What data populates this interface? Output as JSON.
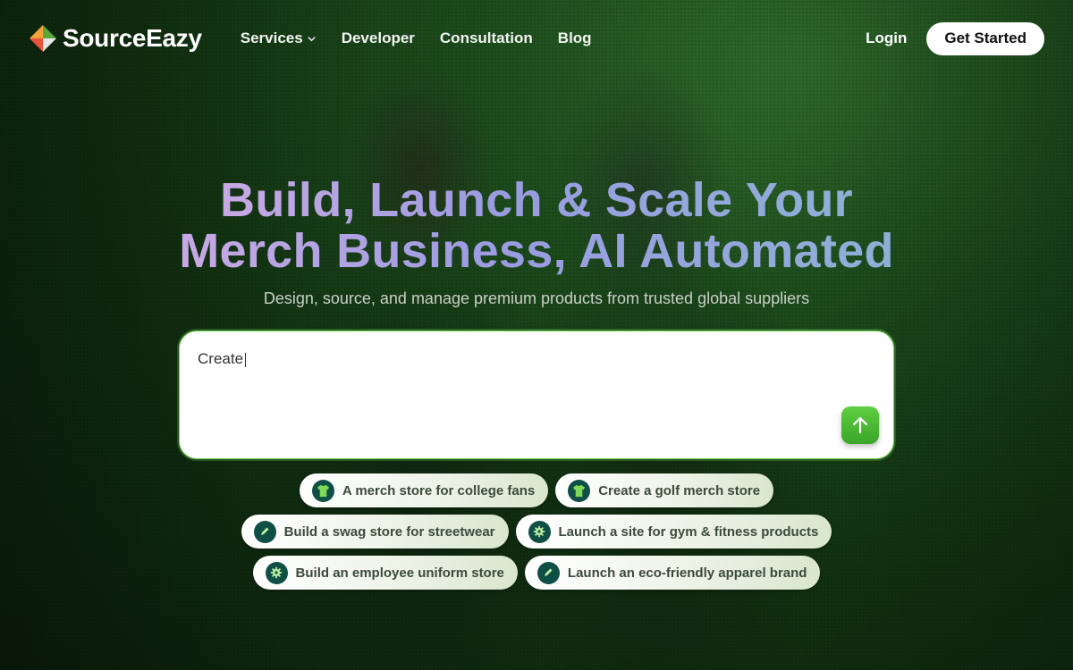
{
  "brand": {
    "name": "SourceEazy",
    "logo_icon": "sourceeazy-logo-icon"
  },
  "nav": {
    "items": [
      {
        "label": "Services",
        "has_dropdown": true
      },
      {
        "label": "Developer"
      },
      {
        "label": "Consultation"
      },
      {
        "label": "Blog"
      }
    ],
    "login_label": "Login",
    "cta_label": "Get Started"
  },
  "hero": {
    "title_line1": "Build, Launch & Scale Your",
    "title_line2": "Merch Business, AI Automated",
    "subtitle": "Design, source, and manage premium products from trusted global suppliers"
  },
  "prompt": {
    "value": "Create",
    "send_icon": "arrow-up-icon"
  },
  "suggestions": [
    [
      {
        "label": "A merch store for college fans",
        "icon": "tshirt-icon"
      },
      {
        "label": "Create a golf merch store",
        "icon": "tshirt-icon"
      }
    ],
    [
      {
        "label": "Build a swag store for streetwear",
        "icon": "pencil-icon"
      },
      {
        "label": "Launch a site for gym & fitness products",
        "icon": "gear-icon"
      }
    ],
    [
      {
        "label": "Build an employee uniform store",
        "icon": "gear-icon"
      },
      {
        "label": "Launch an eco-friendly apparel brand",
        "icon": "pencil-icon"
      }
    ]
  ],
  "colors": {
    "accent_green": "#4bbd33",
    "chip_icon_bg": "#0f4f45",
    "title_gradient_start": "#c8a9e4",
    "title_gradient_end": "#8fb0d6"
  }
}
